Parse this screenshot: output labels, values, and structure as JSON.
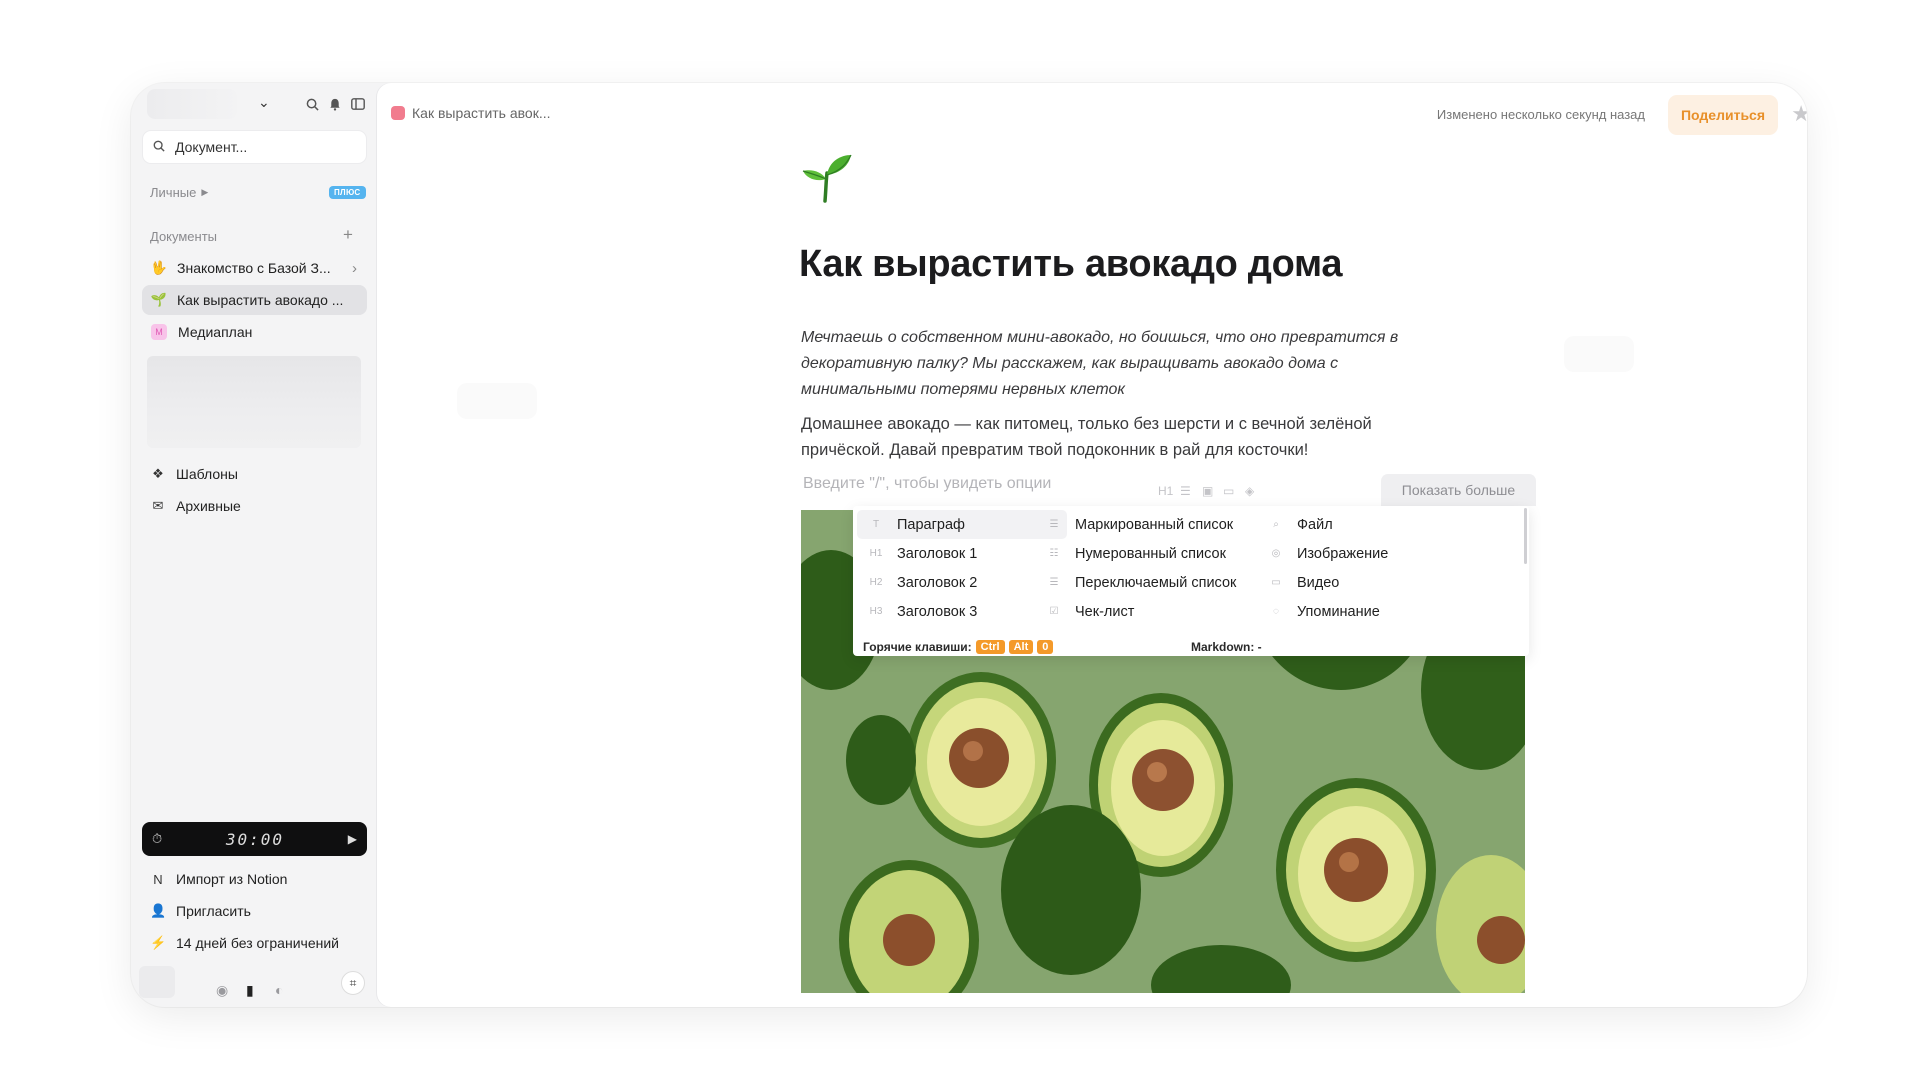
{
  "sidebar": {
    "search_placeholder": "Документ...",
    "personal_label": "Личные",
    "personal_badge": "ПЛЮС",
    "documents_label": "Документы",
    "docs": [
      {
        "emoji": "🖖",
        "label": "Знакомство с Базой З..."
      },
      {
        "emoji": "🌱",
        "label": "Как вырастить авокадо ..."
      },
      {
        "emoji": "М",
        "label": "Медиаплан"
      }
    ],
    "templates_label": "Шаблоны",
    "archive_label": "Архивные",
    "timer_value": "30:00",
    "import_label": "Импорт из Notion",
    "invite_label": "Пригласить",
    "trial_label": "14 дней без ограничений"
  },
  "header": {
    "breadcrumb": "Как вырастить авок...",
    "changed": "Изменено несколько секунд назад",
    "share_label": "Поделиться"
  },
  "doc": {
    "title": "Как вырастить авокадо дома",
    "lead": "Мечтаешь о собственном мини-авокадо, но боишься, что оно превратится в декоративную палку? Мы расскажем, как выращивать авокадо дома с минимальными потерями нервных клеток",
    "paragraph": "Домашнее авокадо — как питомец, только без шерсти и с вечной зелёной причёской. Давай превратим твой подоконник в рай для косточки!",
    "placeholder": "Введите \"/\", чтобы увидеть опции",
    "toolbar_h1": "H1",
    "show_more": "Показать больше"
  },
  "menu": {
    "col1": [
      {
        "icon": "T",
        "label": "Параграф"
      },
      {
        "icon": "H1",
        "label": "Заголовок 1"
      },
      {
        "icon": "H2",
        "label": "Заголовок 2"
      },
      {
        "icon": "H3",
        "label": "Заголовок 3"
      }
    ],
    "col2": [
      {
        "icon": "☰",
        "label": "Маркированный список"
      },
      {
        "icon": "☷",
        "label": "Нумерованный список"
      },
      {
        "icon": "☰",
        "label": "Переключаемый список"
      },
      {
        "icon": "☑",
        "label": "Чек-лист"
      }
    ],
    "col3": [
      {
        "icon": "⌕",
        "label": "Файл"
      },
      {
        "icon": "◎",
        "label": "Изображение"
      },
      {
        "icon": "▭",
        "label": "Видео"
      },
      {
        "icon": "◌",
        "label": "Упоминание"
      }
    ],
    "hotkeys_label": "Горячие клавиши:",
    "keys": [
      "Ctrl",
      "Alt",
      "0"
    ],
    "markdown": "Markdown:  -"
  }
}
